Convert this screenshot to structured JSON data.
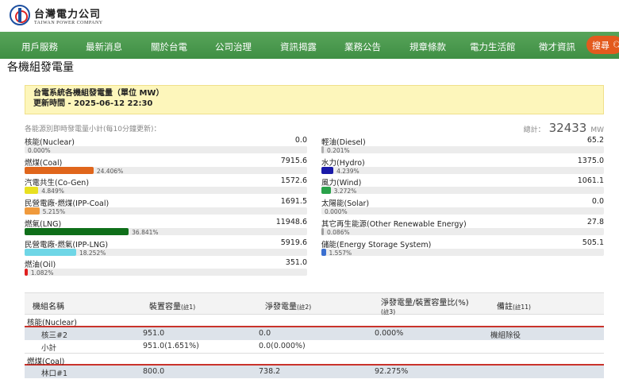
{
  "brand": {
    "name_cn": "台灣電力公司",
    "name_en": "TAIWAN POWER COMPANY"
  },
  "nav": {
    "items": [
      "用戶服務",
      "最新消息",
      "關於台電",
      "公司治理",
      "資訊揭露",
      "業務公告",
      "規章條款",
      "電力生活館",
      "徵才資訊"
    ],
    "search_label": "搜尋"
  },
  "page_title": "各機組發電量",
  "notice": {
    "line1": "台電系統各機組發電量（單位 MW）",
    "line2": "更新時間 - 2025-06-12 22:30"
  },
  "summary": {
    "subtitle": "各能源別即時發電量小計(每10分鐘更新)：",
    "total_label": "總計：",
    "total_value": "32433",
    "total_unit": "MW"
  },
  "colors": {
    "coal": "#e0661c",
    "cogen": "#e8e020",
    "ipp_coal": "#f09a3c",
    "lng": "#0f6f1a",
    "ipp_lng": "#6fd6e6",
    "oil": "#e02020",
    "diesel": "#b0b0b0",
    "hydro": "#1a1aa8",
    "wind": "#2aa24a",
    "storage": "#3a6fd0"
  },
  "energy_left": [
    {
      "label": "核能(Nuclear)",
      "value": "0.0",
      "percent": 0.0,
      "pct_label": "0.000%",
      "color": "#9e9e9e"
    },
    {
      "label": "燃煤(Coal)",
      "value": "7915.6",
      "percent": 24.406,
      "pct_label": "24.406%",
      "color": "#e0661c"
    },
    {
      "label": "汽電共生(Co-Gen)",
      "value": "1572.6",
      "percent": 4.849,
      "pct_label": "4.849%",
      "color": "#e8e020"
    },
    {
      "label": "民營電廠-燃煤(IPP-Coal)",
      "value": "1691.5",
      "percent": 5.215,
      "pct_label": "5.215%",
      "color": "#f09a3c"
    },
    {
      "label": "燃氣(LNG)",
      "value": "11948.6",
      "percent": 36.841,
      "pct_label": "36.841%",
      "color": "#0f6f1a"
    },
    {
      "label": "民營電廠-燃氣(IPP-LNG)",
      "value": "5919.6",
      "percent": 18.252,
      "pct_label": "18.252%",
      "color": "#6fd6e6"
    },
    {
      "label": "燃油(Oil)",
      "value": "351.0",
      "percent": 1.082,
      "pct_label": "1.082%",
      "color": "#e02020"
    }
  ],
  "energy_right": [
    {
      "label": "輕油(Diesel)",
      "value": "65.2",
      "percent": 0.201,
      "pct_label": "0.201%",
      "color": "#b0b0b0"
    },
    {
      "label": "水力(Hydro)",
      "value": "1375.0",
      "percent": 4.239,
      "pct_label": "4.239%",
      "color": "#1a1aa8"
    },
    {
      "label": "風力(Wind)",
      "value": "1061.1",
      "percent": 3.272,
      "pct_label": "3.272%",
      "color": "#2aa24a"
    },
    {
      "label": "太陽能(Solar)",
      "value": "0.0",
      "percent": 0.0,
      "pct_label": "0.000%",
      "color": "#9e9e9e"
    },
    {
      "label": "其它再生能源(Other Renewable Energy)",
      "value": "27.8",
      "percent": 0.086,
      "pct_label": "0.086%",
      "color": "#9e9e9e"
    },
    {
      "label": "儲能(Energy Storage System)",
      "value": "505.1",
      "percent": 1.557,
      "pct_label": "1.557%",
      "color": "#3a6fd0"
    }
  ],
  "table": {
    "headers": {
      "unit_name": "機組名稱",
      "capacity": "裝置容量",
      "capacity_note": "(註1)",
      "net": "淨發電量",
      "net_note": "(註2)",
      "ratio": "淨發電量/裝置容量比(%)",
      "ratio_note": "(註3)",
      "remark": "備註",
      "remark_note": "(註11)"
    },
    "groups": [
      {
        "name": "核能(Nuclear)",
        "rows": [
          {
            "unit": "核三#2",
            "capacity": "951.0",
            "net": "0.0",
            "ratio": "0.000%",
            "remark": "機組除役"
          },
          {
            "unit": "小計",
            "capacity": "951.0(1.651%)",
            "net": "0.0(0.000%)",
            "ratio": "",
            "remark": ""
          }
        ]
      },
      {
        "name": "燃煤(Coal)",
        "rows": [
          {
            "unit": "林口#1",
            "capacity": "800.0",
            "net": "738.2",
            "ratio": "92.275%",
            "remark": ""
          }
        ]
      }
    ]
  }
}
